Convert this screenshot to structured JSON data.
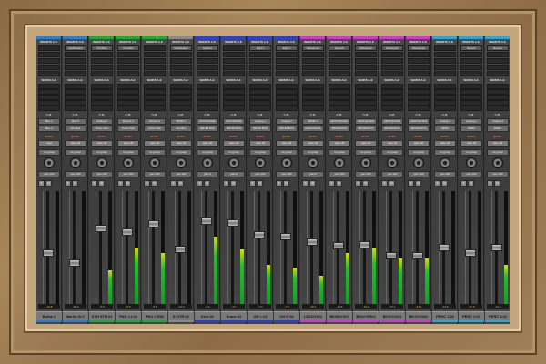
{
  "headers": {
    "inserts": "INSERTS A-E",
    "sends": "SENDS A-E",
    "io": "I / O",
    "auto": "AUTO",
    "group": "no group",
    "mute": "M",
    "solo": "S"
  },
  "channels": [
    {
      "name": "Bulba 2",
      "color": "#2b7fd0",
      "insert": "",
      "input": "Bus 1",
      "output": "Bus 4",
      "auto": "read",
      "pan": "100",
      "vol": "-13.8",
      "level": 0.55,
      "meter": 0.0
    },
    {
      "name": "Marlin DLY",
      "color": "#2b7fd0",
      "insert": "ModDelay3",
      "input": "Bus 5",
      "output": "Ext Bus",
      "auto": "auto off",
      "pan": "100",
      "vol": "-20.0",
      "level": 0.65,
      "meter": 0.0
    },
    {
      "name": "SYN STR.02",
      "color": "#1ea83a",
      "insert": "ChnStrip",
      "input": "Analog 5",
      "output": "Punto Sub",
      "auto": "auto off",
      "pan": "100",
      "vol": "-4.6",
      "level": 0.32,
      "meter": 0.3
    },
    {
      "name": "PNO 1.L02",
      "color": "#1ea83a",
      "insert": "ChnStrip",
      "input": "Reverb 3",
      "output": "Punto Sub",
      "auto": "auto off",
      "pan": "100",
      "vol": "-5.5",
      "level": 0.35,
      "meter": 0.5
    },
    {
      "name": "PNO 2.R02",
      "color": "#1ea83a",
      "insert": "",
      "input": "Return 3",
      "output": "Punto Sub",
      "auto": "auto off",
      "pan": "100",
      "vol": "-3.5",
      "level": 0.28,
      "meter": 0.45
    },
    {
      "name": "E.GTR.02",
      "color": "#8a8a8a",
      "insert": "ModDelay3",
      "input": "SPDIF 1",
      "output": "Inst Bus",
      "auto": "auto off",
      "pan": "100",
      "vol": "-12.0",
      "level": 0.52,
      "meter": 0.0
    },
    {
      "name": "Kick.02",
      "color": "#2c3fd6",
      "insert": "SoftCut",
      "input": "KICKSNARE",
      "output": "DRUM BUS",
      "auto": "auto off",
      "pan": "0",
      "vol": "-2.6",
      "level": 0.25,
      "meter": 0.6
    },
    {
      "name": "Snare.02",
      "color": "#2c3fd6",
      "insert": "",
      "input": "KICKSNARE",
      "output": "DRUM BUS",
      "auto": "auto off",
      "pan": "0",
      "vol": "-3.7",
      "level": 0.27,
      "meter": 0.48
    },
    {
      "name": "OH L.02",
      "color": "#2c3fd6",
      "insert": "EQ3 1",
      "input": "Analog 1",
      "output": "DRUM BUS",
      "auto": "auto off",
      "pan": "100",
      "vol": "-7.3",
      "level": 0.38,
      "meter": 0.35
    },
    {
      "name": "OH R.02",
      "color": "#2c3fd6",
      "insert": "EQ3 1",
      "input": "Analog 2",
      "output": "DRUM BUS",
      "auto": "auto off",
      "pan": "100",
      "vol": "-7.8",
      "level": 0.4,
      "meter": 0.32
    },
    {
      "name": "LEADV102",
      "color": "#c93bd1",
      "insert": "MelodyneI",
      "input": "SPDIF 3",
      "output": "LEADVOCAL",
      "auto": "auto off",
      "pan": "0",
      "vol": "-10.1",
      "level": 0.45,
      "meter": 0.25
    },
    {
      "name": "BKNDVX02",
      "color": "#c93bd1",
      "insert": "Reverb",
      "input": "ADAT2QUAD1",
      "output": "BKNDVOCS",
      "auto": "auto off",
      "pan": "100",
      "vol": "-13.8",
      "level": 0.48,
      "meter": 0.45
    },
    {
      "name": "BKDVXR02",
      "color": "#c93bd1",
      "insert": "MelodyneI",
      "input": "ADATQUAD2",
      "output": "BKNDVOCS",
      "auto": "auto off",
      "pan": "100",
      "vol": "-13.2",
      "level": 0.47,
      "meter": 0.5
    },
    {
      "name": "BKGVX202",
      "color": "#c93bd1",
      "insert": "MelodyneI",
      "input": "ADATQUAD3",
      "output": "BKNDVOCS",
      "auto": "auto off",
      "pan": "100",
      "vol": "-17.1",
      "level": 0.58,
      "meter": 0.4
    },
    {
      "name": "BKGVX202",
      "color": "#c93bd1",
      "insert": "MelodyneI",
      "input": "ADATQUAD4",
      "output": "BKNDVOCS",
      "auto": "auto off",
      "pan": "100",
      "vol": "-17.1",
      "level": 0.58,
      "meter": 0.4
    },
    {
      "name": "PERC 1.02",
      "color": "#26a6d9",
      "insert": "",
      "input": "Analog 1",
      "output": "PERC",
      "auto": "auto off",
      "pan": "100",
      "vol": "-14.8",
      "level": 0.5,
      "meter": 0.0
    },
    {
      "name": "PERC 2.02",
      "color": "#26a6d9",
      "insert": "Reverb",
      "input": "Analog 2",
      "output": "PERC",
      "auto": "auto off",
      "pan": "100",
      "vol": "-17.3",
      "level": 0.55,
      "meter": 0.0
    },
    {
      "name": "PERC 3.02",
      "color": "#26a6d9",
      "insert": "Reverb",
      "input": "Analog 3",
      "output": "PERC",
      "auto": "auto off",
      "pan": "100",
      "vol": "-14.0",
      "level": 0.5,
      "meter": 0.35
    }
  ]
}
